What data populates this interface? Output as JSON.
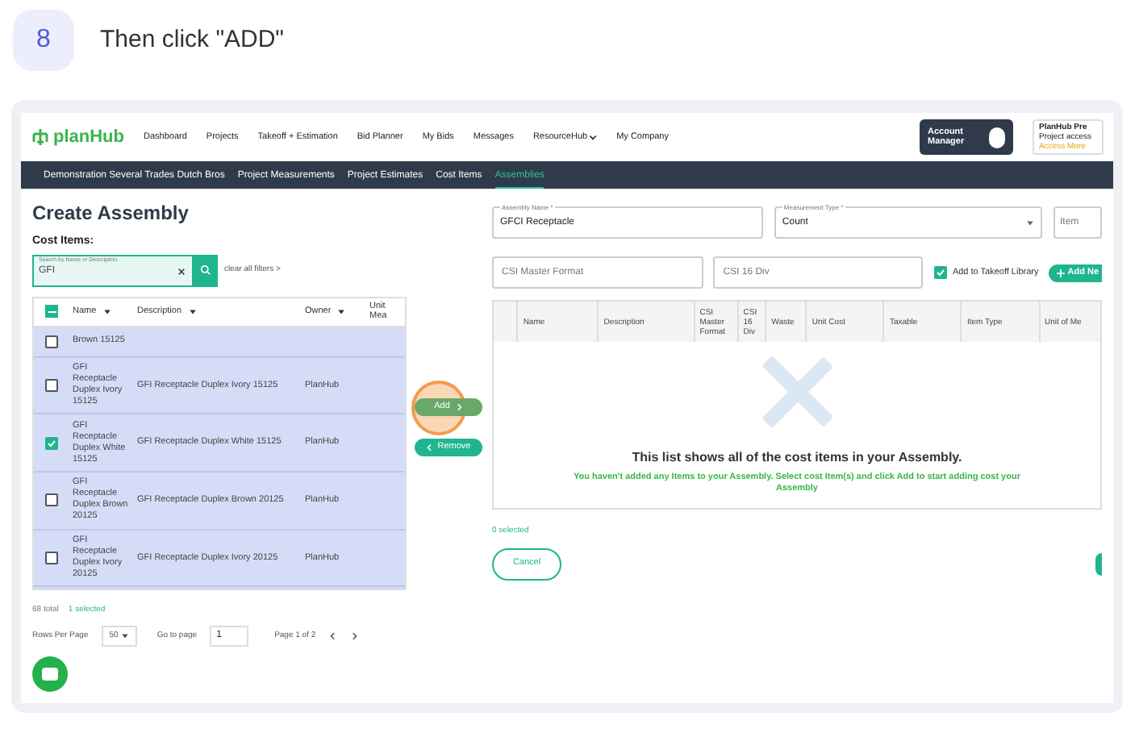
{
  "step": {
    "number": "8",
    "instruction": "Then click \"ADD\""
  },
  "nav": {
    "logo": "planHub",
    "items": [
      "Dashboard",
      "Projects",
      "Takeoff + Estimation",
      "Bid Planner",
      "My Bids",
      "Messages",
      "ResourceHub",
      "My Company"
    ],
    "account_button": "Account Manager",
    "promo": {
      "title": "PlanHub Pre",
      "line": "Project access",
      "link": "Access More"
    }
  },
  "breadcrumb": [
    {
      "label": "Demonstration Several Trades Dutch Bros",
      "selected": false
    },
    {
      "label": "Project Measurements",
      "selected": false
    },
    {
      "label": "Project Estimates",
      "selected": false
    },
    {
      "label": "Cost Items",
      "selected": false
    },
    {
      "label": "Assemblies",
      "selected": true
    }
  ],
  "page_title": "Create Assembly",
  "cost_items": {
    "title": "Cost Items:",
    "search": {
      "label": "Search by Name or Description",
      "value": "GFI"
    },
    "clear_filters": "clear all filters >",
    "columns": [
      "Name",
      "Description",
      "Owner",
      "Unit Mea"
    ],
    "rows": [
      {
        "name": "Brown 15125",
        "checked": false
      },
      {
        "name": "GFI Receptacle Duplex Ivory 15125",
        "description": "GFI Receptacle Duplex Ivory 15125",
        "owner": "PlanHub",
        "checked": false
      },
      {
        "name": "GFI Receptacle Duplex White 15125",
        "description": "GFI Receptacle Duplex White 15125",
        "owner": "PlanHub",
        "checked": true
      },
      {
        "name": "GFI Receptacle Duplex Brown 20125",
        "description": "GFI Receptacle Duplex Brown 20125",
        "owner": "PlanHub",
        "checked": false
      },
      {
        "name": "GFI Receptacle Duplex Ivory 20125",
        "description": "GFI Receptacle Duplex Ivory 20125",
        "owner": "PlanHub",
        "checked": false
      }
    ],
    "total": "68 total",
    "selected_count": "1 selected",
    "rows_per_page_label": "Rows Per Page",
    "rows_per_page": "50",
    "go_to_label": "Go to page",
    "go_to_value": "1",
    "page_info": "Page 1 of 2"
  },
  "transfer": {
    "add": "Add",
    "remove": "Remove"
  },
  "assembly": {
    "name_field": {
      "label": "Assembly Name *",
      "value": "GFCI Receptacle"
    },
    "type_field": {
      "label": "Measurement Type *",
      "value": "Count"
    },
    "item_field": {
      "placeholder": "Item"
    },
    "csi_master": {
      "placeholder": "CSI Master Format"
    },
    "csi_16": {
      "placeholder": "CSI 16 Div"
    },
    "takeoff_library": {
      "label": "Add to Takeoff Library",
      "checked": true
    },
    "add_new": "Add Ne",
    "columns": [
      "Name",
      "Description",
      "CSI Master Format",
      "CSI 16 Div",
      "Waste",
      "Unit Cost",
      "Taxable",
      "Item Type",
      "Unit of Me"
    ],
    "empty_title": "This list shows all of the cost items in your Assembly.",
    "empty_text": "You haven't added any Items to your Assembly. Select cost Item(s) and click Add to start adding cost your Assembly",
    "selected_count": "0 selected",
    "cancel": "Cancel"
  }
}
